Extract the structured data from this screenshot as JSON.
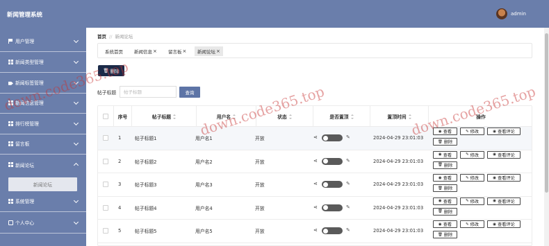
{
  "app": {
    "title": "新闻管理系统",
    "username": "admin"
  },
  "sidebar": {
    "items": [
      {
        "label": "用户管理",
        "icon": "flag-icon"
      },
      {
        "label": "新闻类型管理",
        "icon": "grid-icon"
      },
      {
        "label": "新闻标签管理",
        "icon": "tag-icon"
      },
      {
        "label": "新闻信息管理",
        "icon": "grid-icon"
      },
      {
        "label": "排行榜管理",
        "icon": "grid-icon"
      },
      {
        "label": "留言板",
        "icon": "grid-icon"
      },
      {
        "label": "新闻论坛",
        "icon": "grid-icon"
      },
      {
        "label": "系统管理",
        "icon": "grid-icon"
      },
      {
        "label": "个人中心",
        "icon": "user-card-icon"
      }
    ],
    "sub_item": "新闻论坛"
  },
  "breadcrumb": {
    "home": "首页",
    "separator": "//",
    "current": "新闻论坛"
  },
  "tabs": [
    {
      "label": "系统首页",
      "closable": false
    },
    {
      "label": "新闻信息",
      "closable": true
    },
    {
      "label": "留言板",
      "closable": true
    },
    {
      "label": "新闻论坛",
      "closable": true
    }
  ],
  "toolbar": {
    "delete_label": "删除"
  },
  "search": {
    "label": "帖子标题",
    "placeholder": "帖子标题",
    "button": "查询"
  },
  "table": {
    "headers": [
      "序号",
      "帖子标题",
      "用户名",
      "状态",
      "是否置顶",
      "置顶时间",
      "操作"
    ],
    "rows": [
      {
        "index": "1",
        "title": "帖子标题1",
        "user": "用户名1",
        "status": "开放",
        "time": "2024-04-29 23:01:03"
      },
      {
        "index": "2",
        "title": "帖子标题2",
        "user": "用户名2",
        "status": "开放",
        "time": "2024-04-29 23:01:03"
      },
      {
        "index": "3",
        "title": "帖子标题3",
        "user": "用户名3",
        "status": "开放",
        "time": "2024-04-29 23:01:03"
      },
      {
        "index": "4",
        "title": "帖子标题4",
        "user": "用户名4",
        "status": "开放",
        "time": "2024-04-29 23:01:03"
      },
      {
        "index": "5",
        "title": "帖子标题5",
        "user": "用户名5",
        "status": "开放",
        "time": "2024-04-29 23:01:03"
      }
    ],
    "actions": {
      "view": "查看",
      "edit": "修改",
      "comments": "查看评论",
      "delete": "删除"
    }
  },
  "watermark": "down.code365.top",
  "colors": {
    "sidebar": "#6a7eab",
    "primary_dark": "#1b2a48",
    "query_button": "#5d74a6"
  }
}
